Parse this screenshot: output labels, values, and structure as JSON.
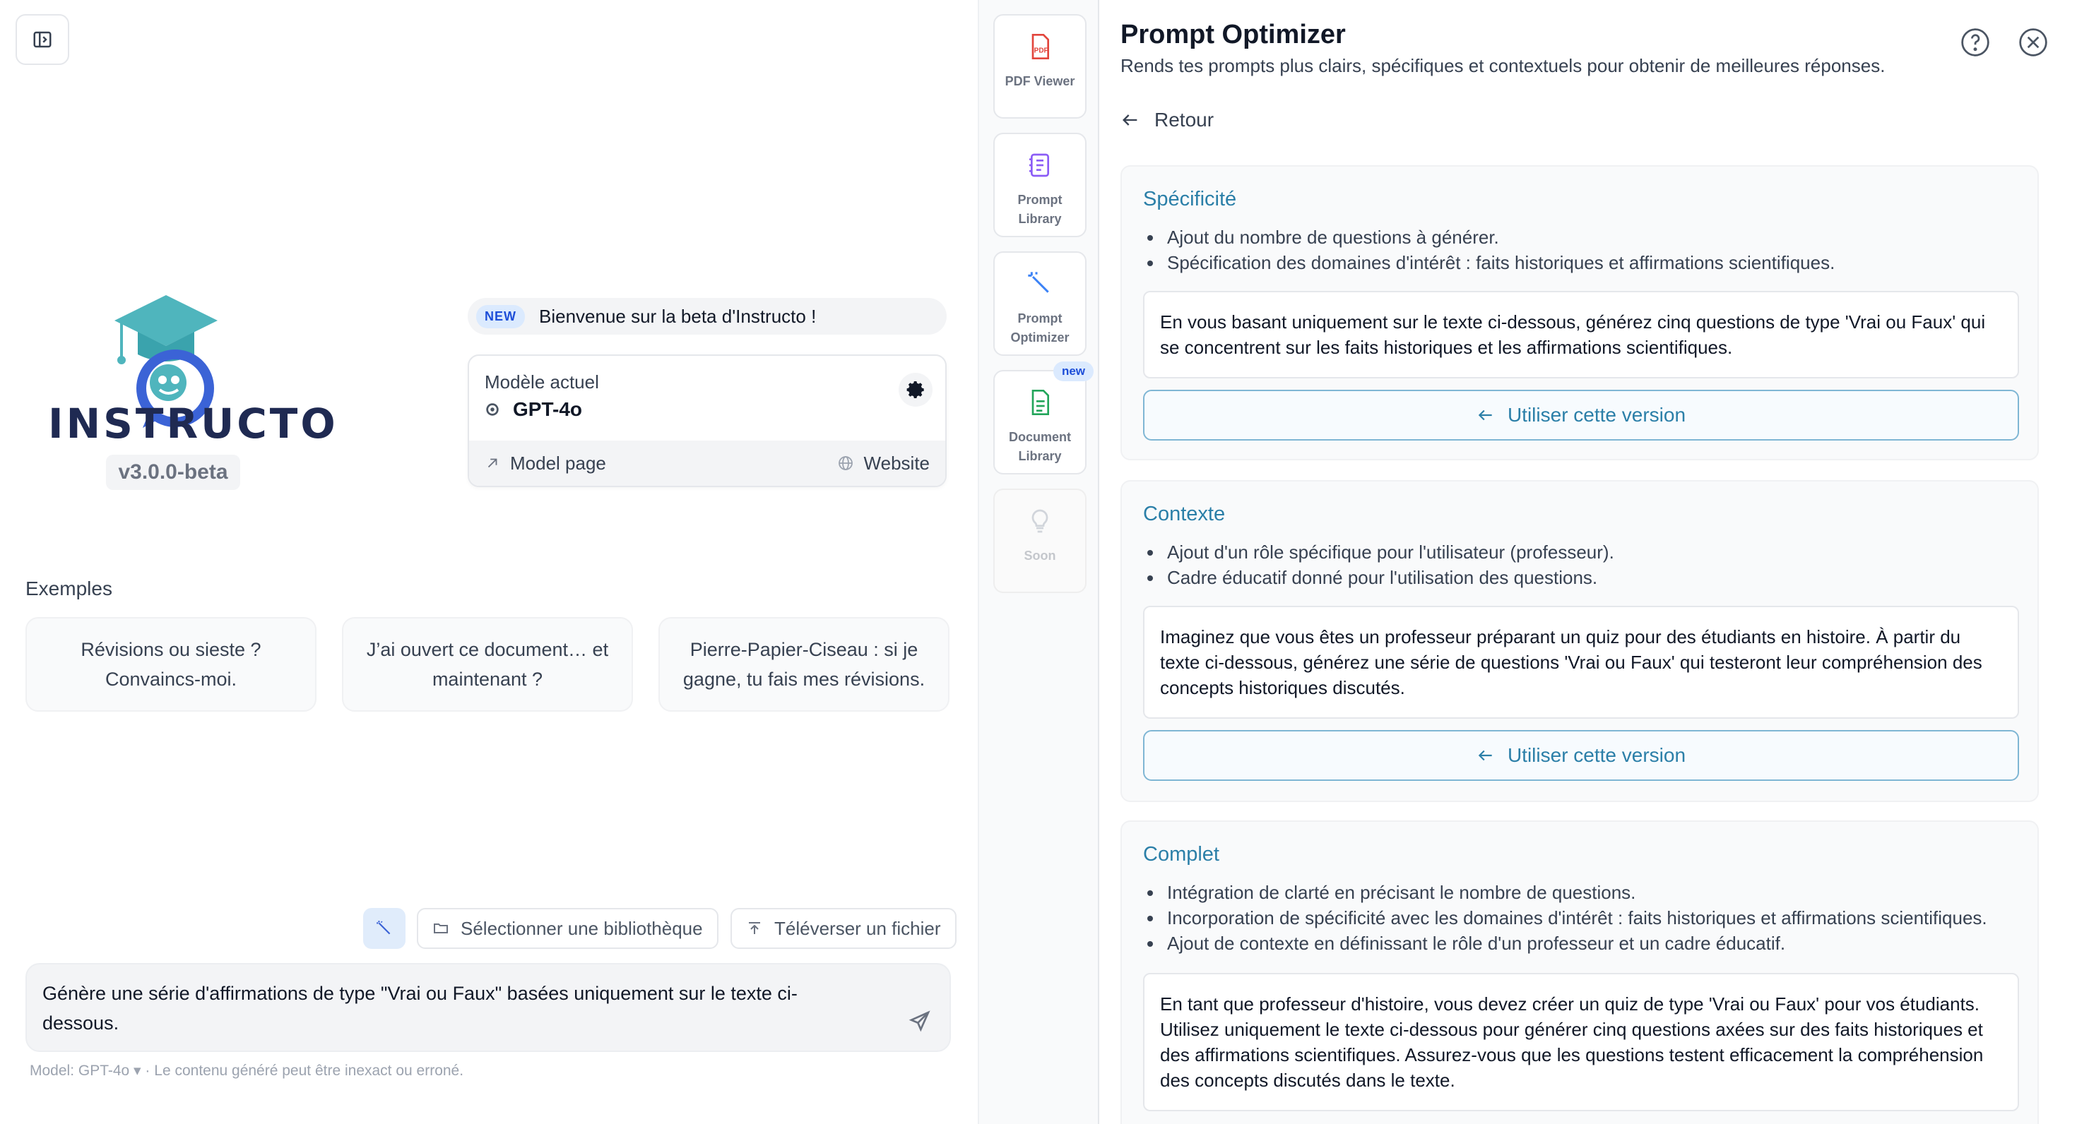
{
  "left": {
    "logo_text": "INSTRUCTO",
    "version": "v3.0.0-beta",
    "welcome": {
      "badge": "NEW",
      "text": "Bienvenue sur la beta d'Instructo !"
    },
    "model_card": {
      "label": "Modèle actuel",
      "model_name": "GPT-4o",
      "model_page": "Model page",
      "website": "Website"
    },
    "examples_title": "Exemples",
    "examples": [
      "Révisions ou sieste ? Convaincs-moi.",
      "J’ai ouvert ce document… et maintenant ?",
      "Pierre-Papier-Ciseau : si je gagne, tu fais mes révisions."
    ],
    "toolbar": {
      "select_library": "Sélectionner une bibliothèque",
      "upload_file": "Téléverser un fichier"
    },
    "composer_text": "Génère une série d'affirmations de type \"Vrai ou Faux\" basées uniquement sur le texte ci-dessous.",
    "disclaimer": "Model: GPT-4o ▾ · Le contenu généré peut être inexact ou erroné."
  },
  "rail": {
    "items": [
      {
        "label": "PDF Viewer",
        "icon": "pdf-icon"
      },
      {
        "label": "Prompt Library",
        "icon": "library-icon"
      },
      {
        "label": "Prompt Optimizer",
        "icon": "wand-icon"
      },
      {
        "label": "Document Library",
        "icon": "document-icon",
        "badge": "new"
      },
      {
        "label": "Soon",
        "icon": "lightbulb-icon"
      }
    ]
  },
  "right": {
    "title": "Prompt Optimizer",
    "subtitle": "Rends tes prompts plus clairs, spécifiques et contextuels pour obtenir de meilleures réponses.",
    "back": "Retour",
    "use_label": "Utiliser cette version",
    "sections": [
      {
        "title": "Spécificité",
        "bullets": [
          "Ajout du nombre de questions à générer.",
          "Spécification des domaines d'intérêt : faits historiques et affirmations scientifiques."
        ],
        "prompt": "En vous basant uniquement sur le texte ci-dessous, générez cinq questions de type 'Vrai ou Faux' qui se concentrent sur les faits historiques et les affirmations scientifiques."
      },
      {
        "title": "Contexte",
        "bullets": [
          "Ajout d'un rôle spécifique pour l'utilisateur (professeur).",
          "Cadre éducatif donné pour l'utilisation des questions."
        ],
        "prompt": "Imaginez que vous êtes un professeur préparant un quiz pour des étudiants en histoire. À partir du texte ci-dessous, générez une série de questions 'Vrai ou Faux' qui testeront leur compréhension des concepts historiques discutés."
      },
      {
        "title": "Complet",
        "bullets": [
          "Intégration de clarté en précisant le nombre de questions.",
          "Incorporation de spécificité avec les domaines d'intérêt : faits historiques et affirmations scientifiques.",
          "Ajout de contexte en définissant le rôle d'un professeur et un cadre éducatif."
        ],
        "prompt": "En tant que professeur d'histoire, vous devez créer un quiz de type 'Vrai ou Faux' pour vos étudiants. Utilisez uniquement le texte ci-dessous pour générer cinq questions axées sur des faits historiques et des affirmations scientifiques. Assurez-vous que les questions testent efficacement la compréhension des concepts discutés dans le texte."
      }
    ]
  },
  "colors": {
    "accent": "#2b7fa8",
    "logo_teal": "#4fb5bd",
    "logo_blue": "#3b63d6",
    "logo_navy": "#1f2a52"
  }
}
